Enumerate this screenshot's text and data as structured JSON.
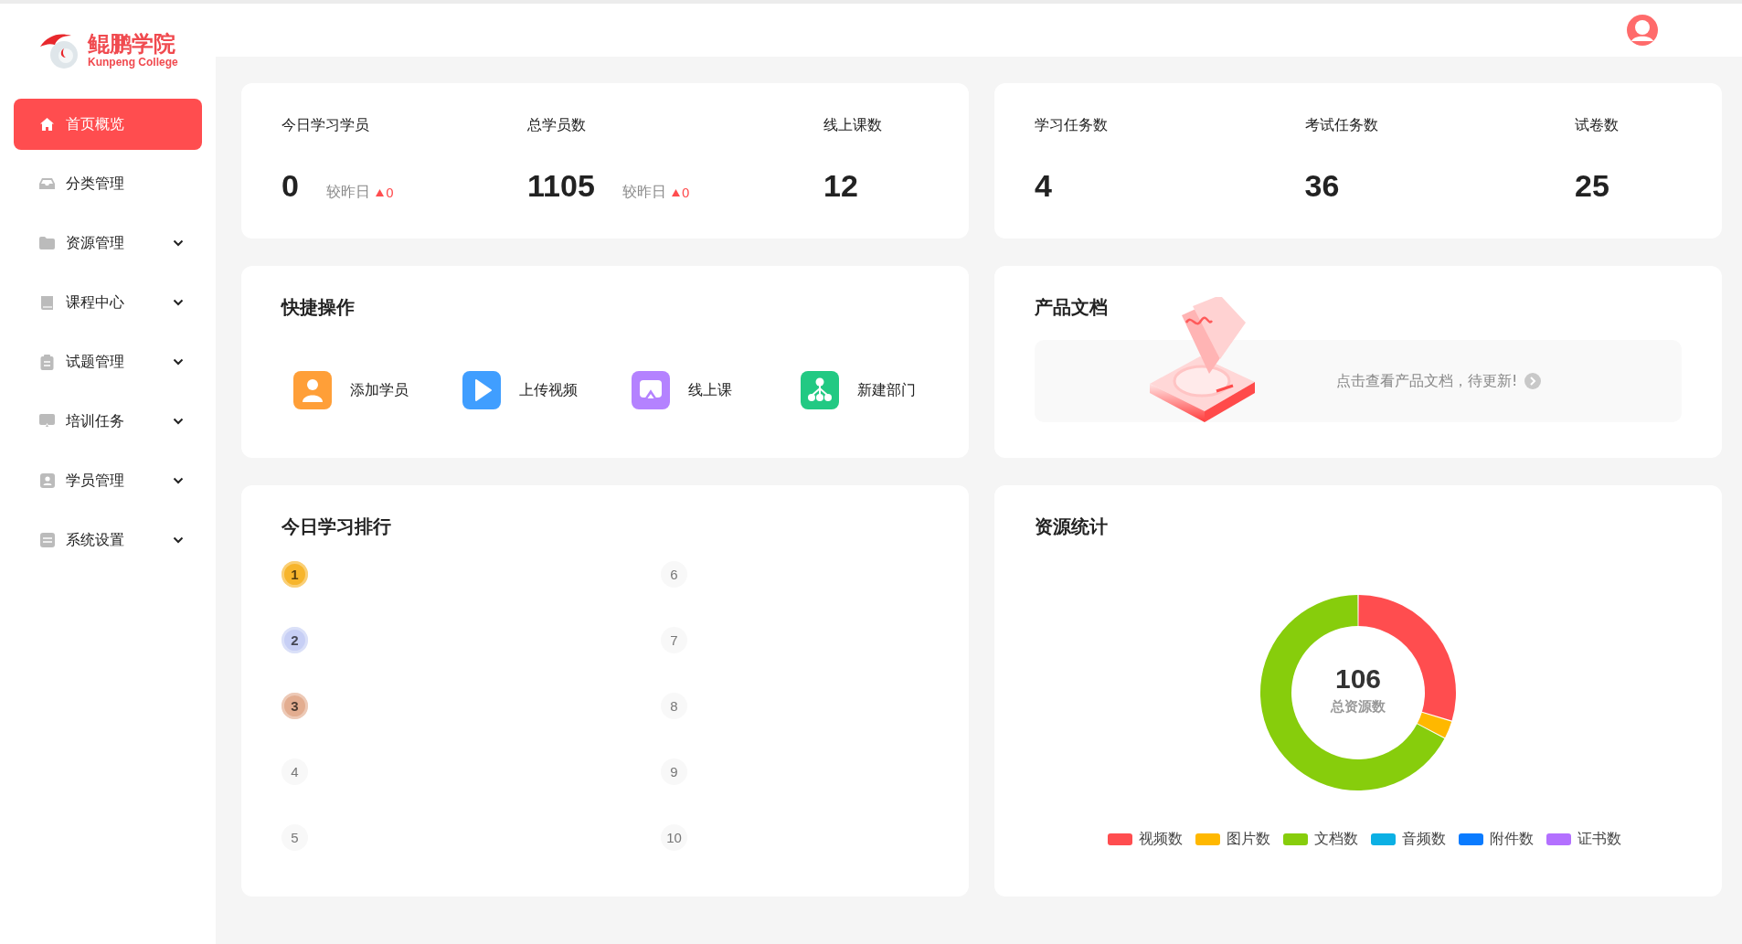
{
  "logo": {
    "name": "鲲鹏学院",
    "subtitle": "Kunpeng College"
  },
  "sidebar": {
    "items": [
      {
        "label": "首页概览",
        "selected": true,
        "has_submenu": false
      },
      {
        "label": "分类管理",
        "selected": false,
        "has_submenu": false
      },
      {
        "label": "资源管理",
        "selected": false,
        "has_submenu": true
      },
      {
        "label": "课程中心",
        "selected": false,
        "has_submenu": true
      },
      {
        "label": "试题管理",
        "selected": false,
        "has_submenu": true
      },
      {
        "label": "培训任务",
        "selected": false,
        "has_submenu": true
      },
      {
        "label": "学员管理",
        "selected": false,
        "has_submenu": true
      },
      {
        "label": "系统设置",
        "selected": false,
        "has_submenu": true
      }
    ]
  },
  "stat_cards": [
    {
      "items": [
        {
          "label": "今日学习学员",
          "value": "0",
          "compare": "较昨日",
          "delta": "0"
        },
        {
          "label": "总学员数",
          "value": "1105",
          "compare": "较昨日",
          "delta": "0"
        },
        {
          "label": "线上课数",
          "value": "12"
        }
      ]
    },
    {
      "items": [
        {
          "label": "学习任务数",
          "value": "4"
        },
        {
          "label": "考试任务数",
          "value": "36"
        },
        {
          "label": "试卷数",
          "value": "25"
        }
      ]
    }
  ],
  "quick_actions": {
    "title": "快捷操作",
    "items": [
      {
        "label": "添加学员",
        "color": "#ff9f38"
      },
      {
        "label": "上传视频",
        "color": "#409eff"
      },
      {
        "label": "线上课",
        "color": "#b482ff"
      },
      {
        "label": "新建部门",
        "color": "#22c983"
      }
    ]
  },
  "product_docs": {
    "title": "产品文档",
    "link": "点击查看产品文档，待更新!"
  },
  "ranking": {
    "title": "今日学习排行",
    "items": [
      {
        "rank": "1",
        "kind": "medal",
        "color": "#f7b52c"
      },
      {
        "rank": "2",
        "kind": "medal",
        "color": "#c7cff5"
      },
      {
        "rank": "3",
        "kind": "medal",
        "color": "#e3ad90"
      },
      {
        "rank": "4",
        "kind": "plain"
      },
      {
        "rank": "5",
        "kind": "plain"
      },
      {
        "rank": "6",
        "kind": "plain"
      },
      {
        "rank": "7",
        "kind": "plain"
      },
      {
        "rank": "8",
        "kind": "plain"
      },
      {
        "rank": "9",
        "kind": "plain"
      },
      {
        "rank": "10",
        "kind": "plain"
      }
    ]
  },
  "resources": {
    "title": "资源统计",
    "total": "106",
    "total_label": "总资源数",
    "legend": [
      {
        "label": "视频数",
        "color": "#ff4d4f"
      },
      {
        "label": "图片数",
        "color": "#ffb800"
      },
      {
        "label": "文档数",
        "color": "#87cd0c"
      },
      {
        "label": "音频数",
        "color": "#0cb0e4"
      },
      {
        "label": "附件数",
        "color": "#0a7bff"
      },
      {
        "label": "证书数",
        "color": "#b370ff"
      }
    ]
  }
}
